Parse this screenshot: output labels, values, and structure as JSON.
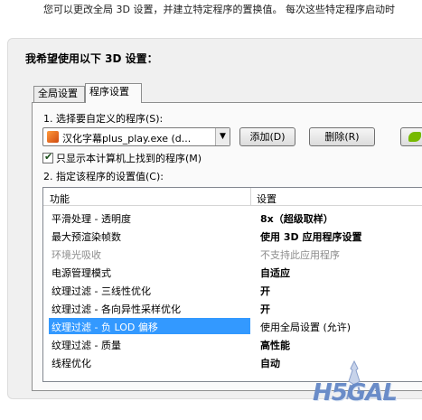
{
  "intro_text": "您可以更改全局 3D 设置，并建立特定程序的置换值。 每次这些特定程序启动时",
  "heading": "我希望使用以下 3D 设置：",
  "tabs": {
    "global": "全局设置",
    "program": "程序设置"
  },
  "step1_label": "1. 选择要自定义的程序(S):",
  "program_select": {
    "value": "汉化字幕plus_play.exe (d...",
    "icon": "program-icon"
  },
  "buttons": {
    "add": "添加(D)",
    "delete": "删除(R)"
  },
  "checkbox": {
    "label": "只显示本计算机上找到的程序(M)",
    "checked": true
  },
  "step2_label": "2. 指定该程序的设置值(C):",
  "grid": {
    "header": {
      "function": "功能",
      "setting": "设置"
    },
    "rows": [
      {
        "function": "平滑处理 - 透明度",
        "setting": "8x（超级取样）"
      },
      {
        "function": "最大预渲染帧数",
        "setting": "使用 3D 应用程序设置"
      },
      {
        "function": "环境光吸收",
        "setting": "不支持此应用程序"
      },
      {
        "function": "电源管理模式",
        "setting": "自适应"
      },
      {
        "function": "纹理过滤 - 三线性优化",
        "setting": "开"
      },
      {
        "function": "纹理过滤 - 各向异性采样优化",
        "setting": "开"
      },
      {
        "function": "纹理过滤 - 负 LOD 偏移",
        "setting": "使用全局设置 (允许)"
      },
      {
        "function": "纹理过滤 - 质量",
        "setting": "高性能"
      },
      {
        "function": "线程优化",
        "setting": "自动"
      }
    ]
  },
  "watermark": "H5GAL",
  "colors": {
    "selection": "#3399ff",
    "nvidia": "#76b900",
    "disabled_text": "#8c8c8c"
  }
}
